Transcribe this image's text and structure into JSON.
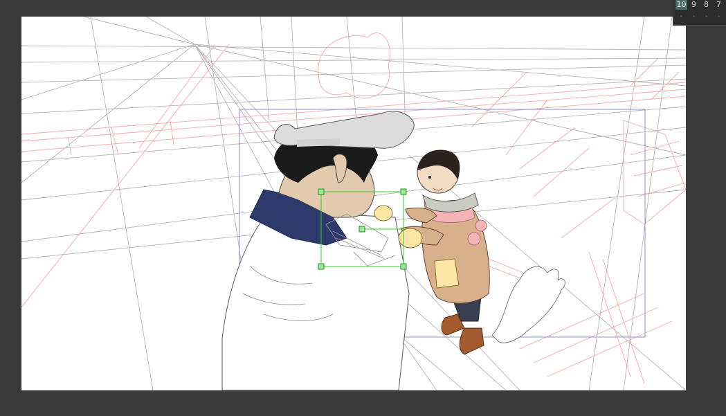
{
  "timeline": {
    "frames": [
      {
        "label": "10",
        "active": true
      },
      {
        "label": "9",
        "active": false
      },
      {
        "label": "8",
        "active": false
      },
      {
        "label": "7",
        "active": false
      }
    ],
    "markers": [
      "-",
      "-",
      "-",
      "-"
    ]
  },
  "colors": {
    "background": "#3a3a3a",
    "canvas": "#ffffff",
    "guide_lines": "#b0b0b0",
    "rough_sketch": "#f3a6a6",
    "camera_frame": "#8c8ccc",
    "selection": "#33cc33",
    "hair": "#1a1a1a",
    "skin": "#e3c9ad",
    "jacket_collar": "#2d3a6b",
    "coat": "#d9b08c",
    "pocket": "#fbe6a6",
    "scarf": "#f5b5b8",
    "boots": "#a25a2e",
    "pants": "#3a3f52"
  },
  "icons": [
    "transform-handle-icon"
  ]
}
